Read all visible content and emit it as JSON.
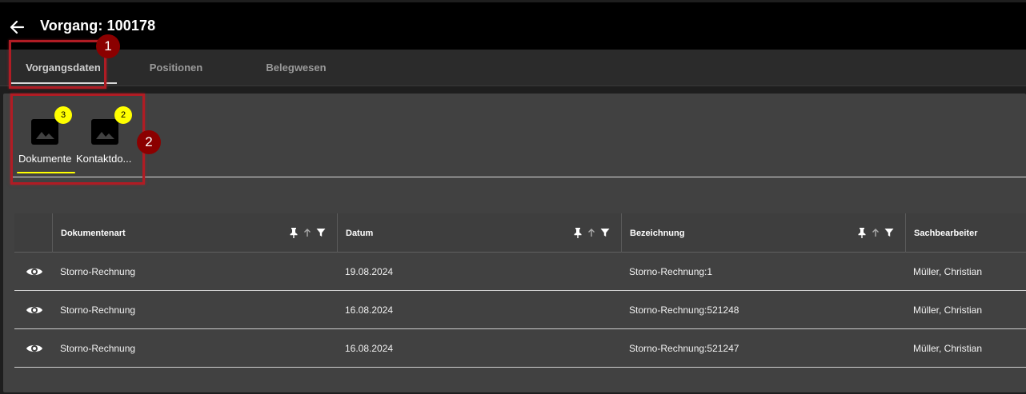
{
  "header": {
    "title": "Vorgang: 100178"
  },
  "tabs": [
    {
      "label": "Vorgangsdaten",
      "active": true
    },
    {
      "label": "Positionen",
      "active": false
    },
    {
      "label": "Belegwesen",
      "active": false
    }
  ],
  "doc_tabs": [
    {
      "label": "Dokumente",
      "badge": "3",
      "icon": "image-icon",
      "active": true
    },
    {
      "label": "Kontaktdo...",
      "badge": "2",
      "icon": "image-icon",
      "active": false
    }
  ],
  "callouts": [
    "1",
    "2"
  ],
  "table": {
    "columns": [
      "Dokumentenart",
      "Datum",
      "Bezeichnung",
      "Sachbearbeiter"
    ],
    "rows": [
      {
        "art": "Storno-Rechnung",
        "datum": "19.08.2024",
        "bezeichnung": "Storno-Rechnung:1",
        "sachbearbeiter": "Müller, Christian"
      },
      {
        "art": "Storno-Rechnung",
        "datum": "16.08.2024",
        "bezeichnung": "Storno-Rechnung:521248",
        "sachbearbeiter": "Müller, Christian"
      },
      {
        "art": "Storno-Rechnung",
        "datum": "16.08.2024",
        "bezeichnung": "Storno-Rechnung:521247",
        "sachbearbeiter": "Müller, Christian"
      }
    ]
  },
  "colors": {
    "badge": "#ffff00",
    "callout": "#8b0000",
    "accent_underline": "#ffff00"
  }
}
